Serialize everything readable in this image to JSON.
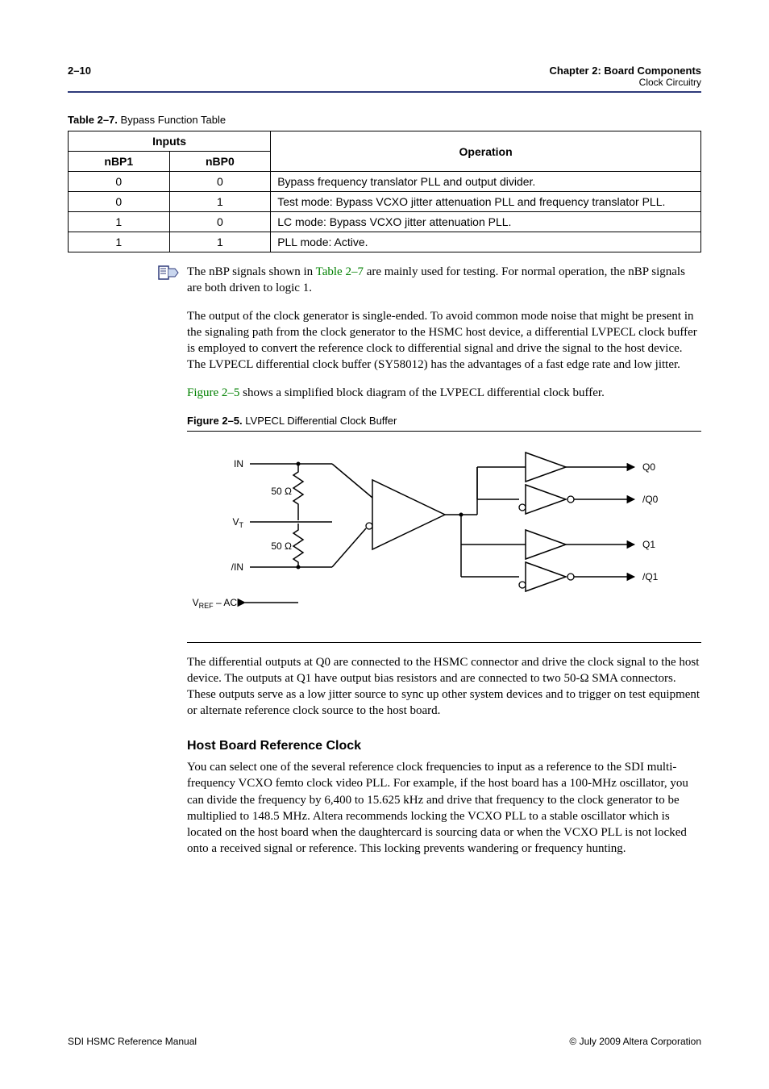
{
  "header": {
    "page_left": "2–10",
    "title_right_line1": "Chapter 2: Board Components",
    "title_right_line2": "Clock Circuitry"
  },
  "table": {
    "caption_bold": "Table 2–7.",
    "caption_rest": " Bypass Function Table",
    "head_inputs": "Inputs",
    "head_op": "Operation",
    "head_nbp1": "nBP1",
    "head_nbp0": "nBP0",
    "rows": [
      {
        "nbp1": "0",
        "nbp0": "0",
        "op": "Bypass frequency translator PLL and output divider."
      },
      {
        "nbp1": "0",
        "nbp0": "1",
        "op": "Test mode: Bypass VCXO jitter attenuation PLL and frequency translator PLL."
      },
      {
        "nbp1": "1",
        "nbp0": "0",
        "op": "LC mode: Bypass VCXO jitter attenuation PLL."
      },
      {
        "nbp1": "1",
        "nbp0": "1",
        "op": "PLL mode: Active."
      }
    ]
  },
  "body": {
    "note_pre": "The nBP signals shown in ",
    "note_link": "Table 2–7",
    "note_post": " are mainly used for testing. For normal operation, the nBP signals are both driven to logic 1.",
    "p2": "The output of the clock generator is single-ended. To avoid common mode noise that might be present in the signaling path from the clock generator to the HSMC host device, a differential LVPECL clock buffer is employed to convert the reference clock to differential signal and drive the signal to the host device. The LVPECL differential clock buffer (SY58012) has the advantages of a fast edge rate and low jitter.",
    "p3_link": "Figure 2–5",
    "p3_post": " shows a simplified block diagram of the LVPECL differential clock buffer.",
    "figcap_bold": "Figure 2–5.",
    "figcap_rest": " LVPECL Differential Clock Buffer",
    "p4": "The differential outputs at Q0 are connected to the HSMC connector and drive the clock signal to the host device. The outputs at Q1 have output bias resistors and are connected to two 50-Ω SMA connectors. These outputs serve as a low jitter source to sync up other system devices and to trigger on test equipment or alternate reference clock source to the host board.",
    "h3": "Host Board Reference Clock",
    "p5": "You can select one of the several reference clock frequencies to input as a reference to the SDI multi-frequency VCXO femto clock video PLL. For example, if the host board has a 100-MHz oscillator, you can divide the frequency by 6,400 to 15.625 kHz and drive that frequency to the clock generator to be multiplied to 148.5 MHz. Altera recommends locking the VCXO PLL to a stable oscillator which is located on the host board when the daughtercard is sourcing data or when the VCXO PLL is not locked onto a received signal or reference. This locking prevents wandering or frequency hunting."
  },
  "diagram": {
    "in": "IN",
    "in_n": "/IN",
    "vt": "V",
    "vt_sub": "T",
    "r50a": "50 Ω",
    "r50b": "50 Ω",
    "vref": "V",
    "vref_sub": "REF",
    "vref_post": " – AC",
    "q0": "Q0",
    "q0n": "/Q0",
    "q1": "Q1",
    "q1n": "/Q1"
  },
  "footer": {
    "left": "SDI HSMC Reference Manual",
    "right": "© July 2009   Altera Corporation"
  }
}
